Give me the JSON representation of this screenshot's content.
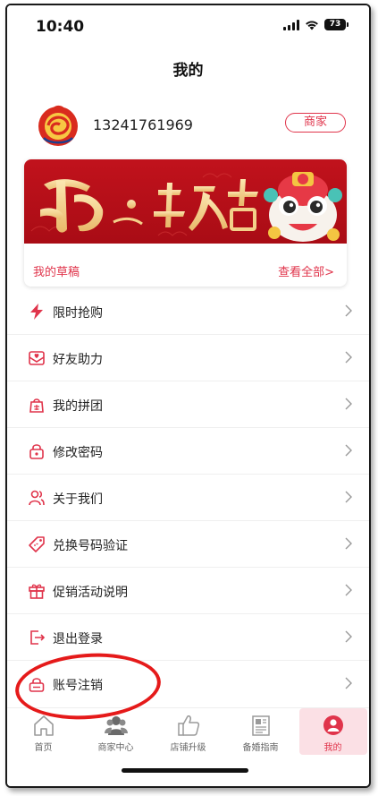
{
  "status_bar": {
    "time": "10:40",
    "battery": "73"
  },
  "header": {
    "title": "我的"
  },
  "profile": {
    "phone": "13241761969",
    "merchant_label": "商家"
  },
  "banner": {
    "drafts_label": "我的草稿",
    "view_all_label": "查看全部>"
  },
  "menu": {
    "items": [
      {
        "label": "限时抢购",
        "icon": "lightning-icon"
      },
      {
        "label": "好友助力",
        "icon": "heart-envelope-icon"
      },
      {
        "label": "我的拼团",
        "icon": "group-bag-icon"
      },
      {
        "label": "修改密码",
        "icon": "lock-icon"
      },
      {
        "label": "关于我们",
        "icon": "people-icon"
      },
      {
        "label": "兑换号码验证",
        "icon": "tag-icon"
      },
      {
        "label": "促销活动说明",
        "icon": "gift-icon"
      },
      {
        "label": "退出登录",
        "icon": "logout-icon"
      },
      {
        "label": "账号注销",
        "icon": "account-lock-icon"
      }
    ]
  },
  "tabbar": {
    "tabs": [
      {
        "label": "首页",
        "icon": "home-icon",
        "active": false
      },
      {
        "label": "商家中心",
        "icon": "merchant-icon",
        "active": false
      },
      {
        "label": "店铺升级",
        "icon": "thumbs-up-icon",
        "active": false
      },
      {
        "label": "备婚指南",
        "icon": "guide-icon",
        "active": false
      },
      {
        "label": "我的",
        "icon": "profile-icon",
        "active": true
      }
    ]
  },
  "colors": {
    "accent": "#e0344b",
    "banner": "#b3101a",
    "annotation": "#e51a1a"
  }
}
